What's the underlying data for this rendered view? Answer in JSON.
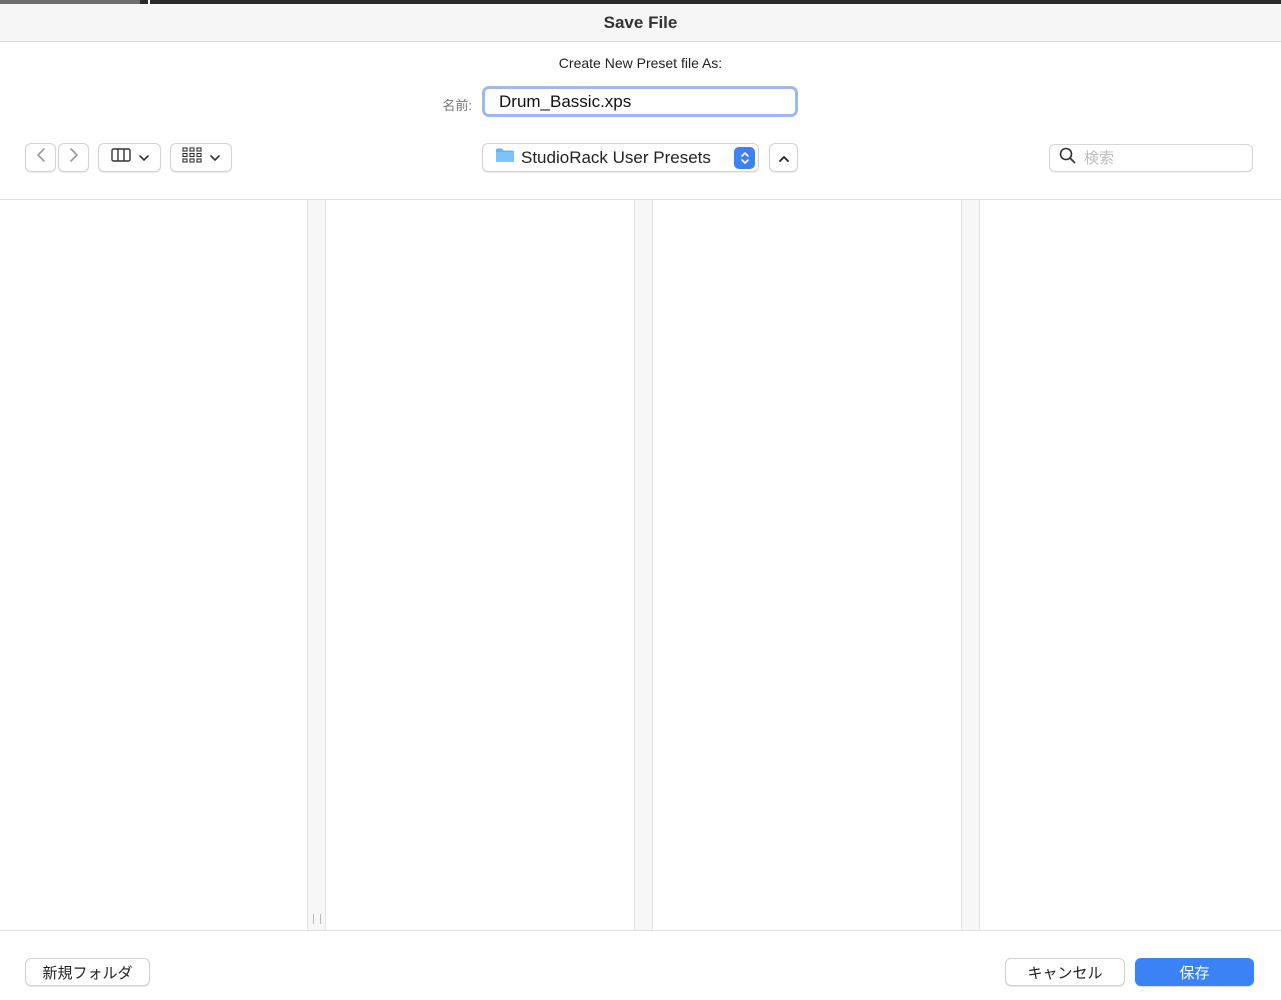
{
  "window": {
    "title": "Save File"
  },
  "prompt": "Create New Preset file As:",
  "name_field": {
    "label": "名前:",
    "value": "Drum_Bassic.xps"
  },
  "toolbar": {
    "back_icon": "chevron-left-icon",
    "forward_icon": "chevron-right-icon",
    "view_mode_icon": "column-view-icon",
    "group_icon": "grid-group-icon",
    "location": "StudioRack User Presets",
    "search_placeholder": "検索"
  },
  "footer": {
    "new_folder": "新規フォルダ",
    "cancel": "キャンセル",
    "save": "保存"
  },
  "colors": {
    "accent": "#3b82f6",
    "focus_ring": "#9cb9f2",
    "folder": "#64b5f6"
  }
}
